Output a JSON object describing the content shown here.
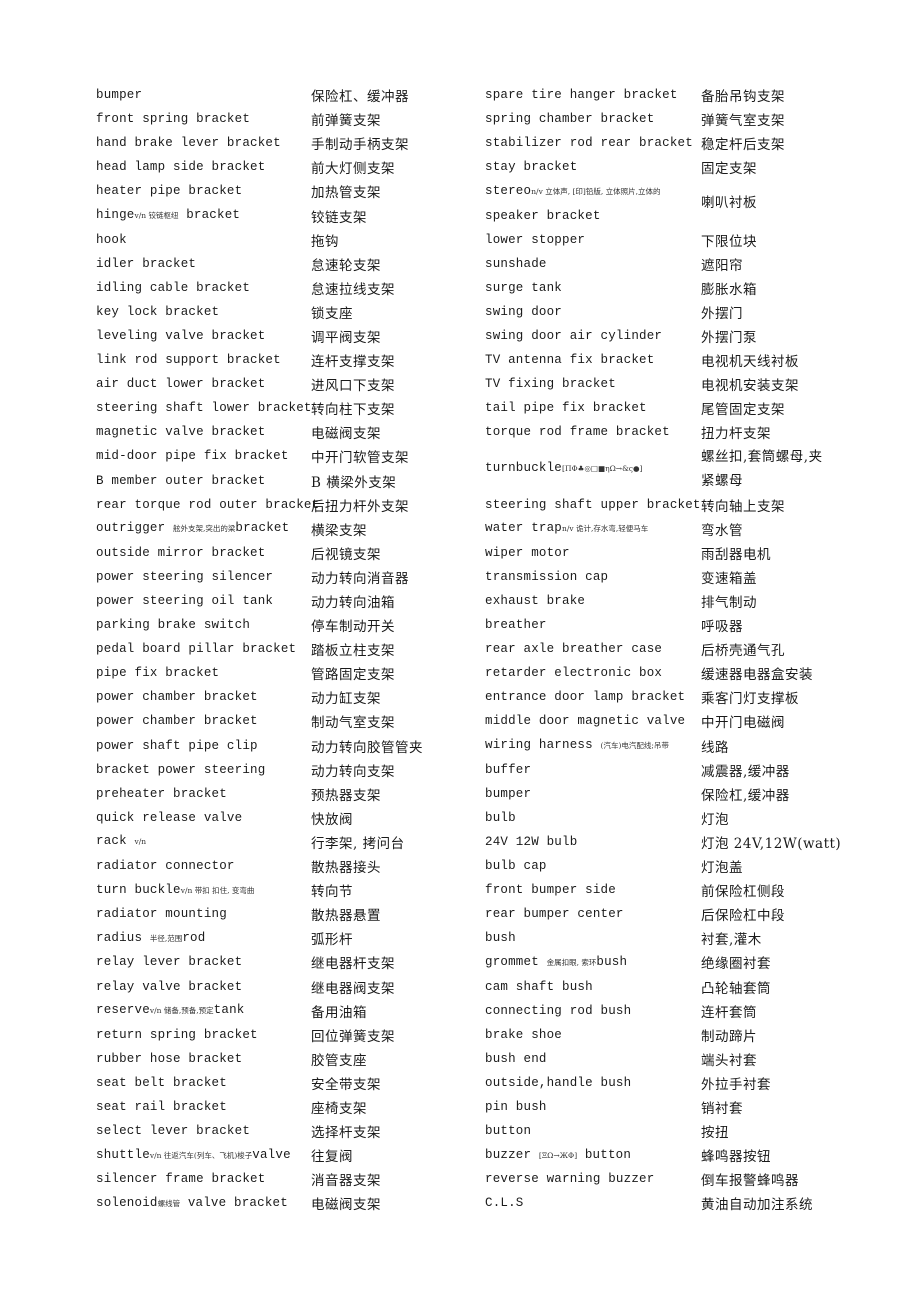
{
  "left_column": [
    {
      "en": "bumper",
      "zh": "保险杠、缓冲器"
    },
    {
      "en": "front spring bracket",
      "zh": "前弹簧支架"
    },
    {
      "en": "hand brake lever bracket",
      "zh": "手制动手柄支架"
    },
    {
      "en": "head lamp side bracket",
      "zh": "前大灯侧支架"
    },
    {
      "en": "heater pipe bracket",
      "zh": "加热管支架"
    },
    {
      "en_pre": "hinge",
      "note": "v/n 铰链枢纽",
      "en_post": " bracket",
      "zh": "铰链支架"
    },
    {
      "en": "hook",
      "zh": "拖钩"
    },
    {
      "en": "idler bracket",
      "zh": "怠速轮支架"
    },
    {
      "en": "idling cable bracket",
      "zh": "怠速拉线支架"
    },
    {
      "en": "key lock bracket",
      "zh": "锁支座"
    },
    {
      "en": "leveling valve bracket",
      "zh": "调平阀支架"
    },
    {
      "en": "link rod support bracket",
      "zh": "连杆支撑支架"
    },
    {
      "en": "air duct lower bracket",
      "zh": "进风口下支架"
    },
    {
      "en": "steering shaft lower bracket",
      "zh": "转向柱下支架"
    },
    {
      "en": "magnetic valve bracket",
      "zh": "电磁阀支架"
    },
    {
      "en": "mid-door pipe fix bracket",
      "zh": "中开门软管支架"
    },
    {
      "en": "B member outer bracket",
      "zh": "B 横梁外支架"
    },
    {
      "en": "rear torque rod outer bracket",
      "zh": "后扭力杆外支架"
    },
    {
      "en_pre": "outrigger ",
      "note": "舷外支架,突出的梁",
      "en_post": "bracket",
      "zh": "横梁支架"
    },
    {
      "en": "outside mirror bracket",
      "zh": "后视镜支架"
    },
    {
      "en": "power steering silencer",
      "zh": "动力转向消音器"
    },
    {
      "en": "power steering oil tank",
      "zh": "动力转向油箱"
    },
    {
      "en": "parking brake switch",
      "zh": "停车制动开关"
    },
    {
      "en": "pedal board pillar bracket",
      "zh": "踏板立柱支架"
    },
    {
      "en": "pipe fix bracket",
      "zh": "管路固定支架"
    },
    {
      "en": "power chamber bracket",
      "zh": "动力缸支架"
    },
    {
      "en": "power chamber bracket",
      "zh": "制动气室支架"
    },
    {
      "en": "power shaft pipe clip",
      "zh": "动力转向胶管管夹"
    },
    {
      "en": "bracket power steering",
      "zh": "动力转向支架"
    },
    {
      "en": "preheater bracket",
      "zh": "预热器支架"
    },
    {
      "en": "quick release valve",
      "zh": "快放阀"
    },
    {
      "en_pre": "rack ",
      "note": "v/n",
      "en_post": "",
      "zh": "行李架, 拷问台"
    },
    {
      "en": "radiator connector",
      "zh": "散热器接头"
    },
    {
      "en_pre": "turn buckle",
      "note": "v/n 带扣 扣住, 变弯曲",
      "en_post": "",
      "zh": "转向节"
    },
    {
      "en": "radiator mounting",
      "zh": "散热器悬置"
    },
    {
      "en_pre": "radius ",
      "note": "半径,范围",
      "en_post": "rod",
      "zh": "弧形杆"
    },
    {
      "en": "relay lever bracket",
      "zh": "继电器杆支架"
    },
    {
      "en": "relay valve bracket",
      "zh": "继电器阀支架"
    },
    {
      "en_pre": "reserve",
      "note": "v/n 储备,预备,预定",
      "en_post": "tank",
      "zh": "备用油箱"
    },
    {
      "en": "return spring bracket",
      "zh": "回位弹簧支架"
    },
    {
      "en": "rubber hose bracket",
      "zh": "胶管支座"
    },
    {
      "en": "seat belt bracket",
      "zh": "安全带支架"
    },
    {
      "en": "seat rail bracket",
      "zh": "座椅支架"
    },
    {
      "en": "select lever bracket",
      "zh": "选择杆支架"
    },
    {
      "en_pre": "shuttle",
      "note": "v/n 往返汽车(列车、飞机)梭子",
      "en_post": "valve",
      "zh": "往复阀"
    },
    {
      "en": "silencer frame bracket",
      "zh": "消音器支架"
    },
    {
      "en_pre": "solenoid",
      "note": "螺线管",
      "en_post": " valve bracket",
      "zh": "电磁阀支架"
    }
  ],
  "right_column": [
    {
      "en": "spare tire hanger bracket",
      "zh": "备胎吊钩支架"
    },
    {
      "en": "spring chamber bracket",
      "zh": "弹簧气室支架"
    },
    {
      "en": "stabilizer rod rear bracket",
      "zh": "稳定杆后支架"
    },
    {
      "en": "stay bracket",
      "zh": "固定支架"
    },
    {
      "tall": true,
      "en_pre": "stereo",
      "note": "n/v 立体声, [印]铅版, 立体照片,立体的",
      "en_post": "speaker bracket",
      "zh": "喇叭衬板"
    },
    {
      "en": "lower stopper",
      "zh": "下限位块"
    },
    {
      "en": "sunshade",
      "zh": "遮阳帘"
    },
    {
      "en": "surge tank",
      "zh": "膨胀水箱"
    },
    {
      "en": "swing door",
      "zh": "外摆门"
    },
    {
      "en": "swing door air cylinder",
      "zh": "外摆门泵"
    },
    {
      "en": "TV antenna fix bracket",
      "zh": "电视机天线衬板"
    },
    {
      "en": "TV fixing bracket",
      "zh": "电视机安装支架"
    },
    {
      "en": "tail pipe fix bracket",
      "zh": "尾管固定支架"
    },
    {
      "en": "torque rod frame bracket",
      "zh": "扭力杆支架"
    },
    {
      "tall": true,
      "en_pre": "turnbuckle",
      "note": "[ΠΦ♣◎□■ηΩ→&ς●]",
      "en_post": "",
      "zh": "螺丝扣,套筒螺母,夹紧螺母"
    },
    {
      "en": "steering shaft upper bracket",
      "zh": "转向轴上支架"
    },
    {
      "en_pre": "water trap",
      "note": "n/v 诡计,存水弯,轻便马车",
      "en_post": "",
      "zh": "弯水管"
    },
    {
      "en": "wiper motor",
      "zh": "雨刮器电机"
    },
    {
      "en": "transmission cap",
      "zh": "变速箱盖"
    },
    {
      "en": "exhaust brake",
      "zh": "排气制动"
    },
    {
      "en": "breather",
      "zh": "呼吸器"
    },
    {
      "en": "rear axle breather case",
      "zh": "后桥壳通气孔"
    },
    {
      "en": "retarder electronic box",
      "zh": "缓速器电器盒安装"
    },
    {
      "en": "entrance door lamp bracket",
      "zh": "乘客门灯支撑板"
    },
    {
      "en": "middle door magnetic valve",
      "zh": "中开门电磁阀"
    },
    {
      "en_pre": "wiring harness ",
      "note": "(汽车)电汽配线;吊带",
      "en_post": "",
      "zh": "线路"
    },
    {
      "en": "buffer",
      "zh": "减震器,缓冲器"
    },
    {
      "en": "bumper",
      "zh": "保险杠,缓冲器"
    },
    {
      "en": "bulb",
      "zh": "灯泡"
    },
    {
      "en": "24V 12W bulb",
      "zh": "灯泡 24V,12W(watt)"
    },
    {
      "en": "bulb cap",
      "zh": "灯泡盖"
    },
    {
      "en": "front bumper side",
      "zh": "前保险杠侧段"
    },
    {
      "en": "rear bumper center",
      "zh": "后保险杠中段"
    },
    {
      "en": "bush",
      "zh": "衬套,灌木"
    },
    {
      "en_pre": "grommet ",
      "note": "金属扣眼, 索环",
      "en_post": "bush",
      "zh": "绝缘圈衬套"
    },
    {
      "en": "cam shaft bush",
      "zh": "凸轮轴套筒"
    },
    {
      "en": "connecting rod bush",
      "zh": "连杆套筒"
    },
    {
      "en": "brake shoe",
      "zh": "制动蹄片"
    },
    {
      "en": "bush end",
      "zh": "端头衬套"
    },
    {
      "en": "outside,handle bush",
      "zh": "外拉手衬套"
    },
    {
      "en": "pin bush",
      "zh": "销衬套"
    },
    {
      "en": "button",
      "zh": "按扭"
    },
    {
      "en_pre": "buzzer ",
      "note": "[ΞΩ→ЖΦ]",
      "en_post": " button",
      "zh": "蜂鸣器按钮"
    },
    {
      "en": "reverse warning buzzer",
      "zh": "倒车报警蜂鸣器"
    },
    {
      "en": "C.L.S",
      "zh": "黄油自动加注系统"
    }
  ]
}
